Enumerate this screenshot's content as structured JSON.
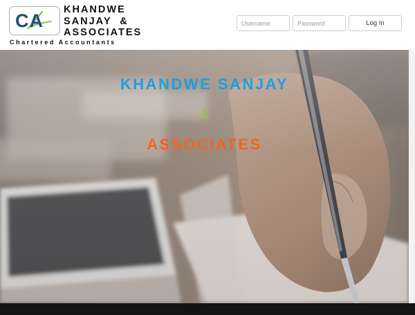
{
  "brand": {
    "logo_text": "CA",
    "name_line1": "KHANDWE",
    "name_line2": "SANJAY  &",
    "name_line3": "ASSOCIATES",
    "tagline": "Chartered Accountants"
  },
  "login": {
    "username_placeholder": "Username",
    "password_placeholder": "Password",
    "button_label": "Log In"
  },
  "hero": {
    "line1": "KHANDWE SANJAY",
    "line2": "&",
    "line3": "ASSOCIATES",
    "colors": {
      "line1": "#1e9fe0",
      "line2": "#8cc63f",
      "line3": "#f26522"
    }
  }
}
